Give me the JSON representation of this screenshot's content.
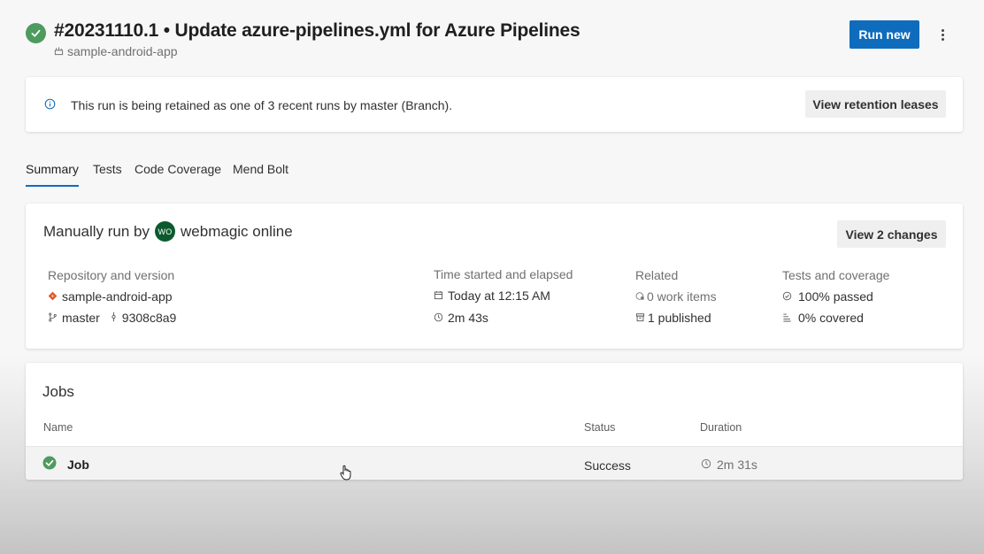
{
  "header": {
    "title": "#20231110.1 • Update azure-pipelines.yml for Azure Pipelines",
    "repo": "sample-android-app",
    "run_new_label": "Run new"
  },
  "retention": {
    "message": "This run is being retained as one of 3 recent runs by master (Branch).",
    "button_label": "View retention leases"
  },
  "tabs": [
    {
      "label": "Summary",
      "active": true
    },
    {
      "label": "Tests",
      "active": false
    },
    {
      "label": "Code Coverage",
      "active": false
    },
    {
      "label": "Mend Bolt",
      "active": false
    }
  ],
  "summary": {
    "manually_run_by": "Manually run by",
    "user_initials": "WO",
    "user_name": "webmagic online",
    "view_changes_label": "View 2 changes",
    "repository": {
      "heading": "Repository and version",
      "repo": "sample-android-app",
      "branch": "master",
      "commit": "9308c8a9"
    },
    "time": {
      "heading": "Time started and elapsed",
      "started": "Today at 12:15 AM",
      "elapsed": "2m 43s"
    },
    "related": {
      "heading": "Related",
      "work_items": "0 work items",
      "published": "1 published"
    },
    "tests": {
      "heading": "Tests and coverage",
      "passed": "100% passed",
      "covered": "0% covered"
    }
  },
  "jobs": {
    "title": "Jobs",
    "columns": {
      "name": "Name",
      "status": "Status",
      "duration": "Duration"
    },
    "rows": [
      {
        "name": "Job",
        "status": "Success",
        "duration": "2m 31s"
      }
    ]
  },
  "colors": {
    "accent": "#0f6cbd",
    "success": "#4e9a5f",
    "avatar": "#0b5a2e",
    "git_orange": "#e05a2b"
  }
}
